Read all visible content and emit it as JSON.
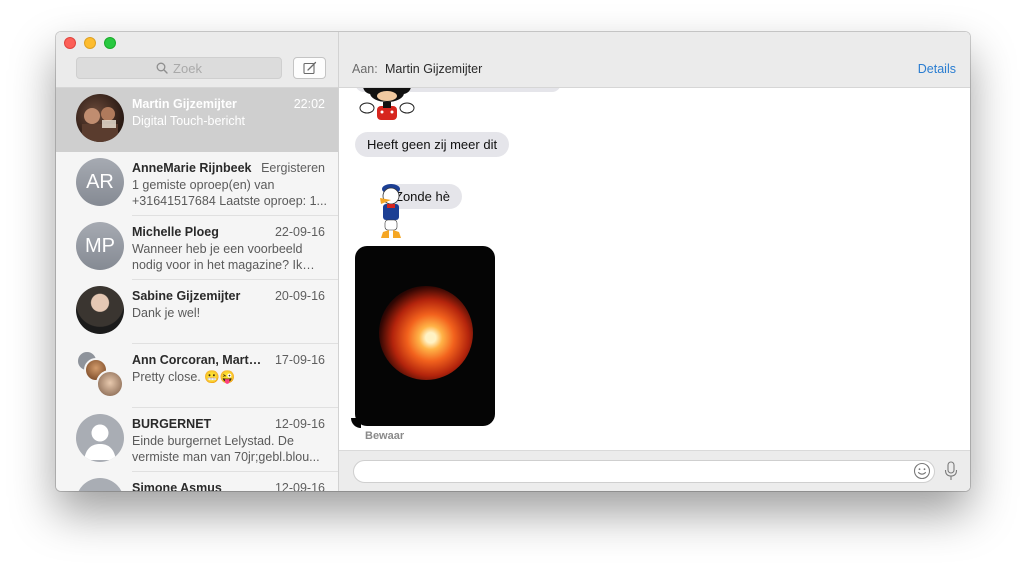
{
  "sidebar": {
    "search_placeholder": "Zoek",
    "conversations": [
      {
        "name": "Martin Gijzemijter",
        "date": "22:02",
        "preview": "Digital Touch-bericht",
        "avatar": "photo",
        "selected": true
      },
      {
        "name": "AnneMarie Rijnbeek",
        "date": "Eergisteren",
        "preview": "1 gemiste oproep(en) van +31641517684 Laatste oproep: 1...",
        "initials": "AR"
      },
      {
        "name": "Michelle Ploeg",
        "date": "22-09-16",
        "preview": "Wanneer heb je een voorbeeld nodig voor in het magazine? Ik lig...",
        "initials": "MP"
      },
      {
        "name": "Sabine Gijzemijter",
        "date": "20-09-16",
        "preview": "Dank je wel!",
        "avatar": "photo"
      },
      {
        "name": "Ann Corcoran, Marti...",
        "date": "17-09-16",
        "preview": "Pretty close. 😬😜",
        "avatar": "group"
      },
      {
        "name": "BURGERNET",
        "date": "12-09-16",
        "preview": "Einde burgernet Lelystad. De vermiste man  van 70jr;gebl.blou...",
        "avatar": "generic"
      },
      {
        "name": "Simone Asmus",
        "date": "12-09-16",
        "preview": "",
        "avatar": "generic"
      }
    ]
  },
  "header": {
    "to_label": "Aan:",
    "recipient": "Martin Gijzemijter",
    "details_label": "Details"
  },
  "transcript": {
    "messages": [
      "Heeft geen zij meer dit",
      "Zonde hè"
    ],
    "save_label": "Bewaar"
  },
  "icons": {
    "search": "search-icon",
    "compose": "compose-icon",
    "emoji": "emoji-icon",
    "mic": "microphone-icon"
  },
  "colors": {
    "accent": "#2a7dd1",
    "selected_row": "#cfcfcf",
    "bubble": "#e5e5ea"
  }
}
